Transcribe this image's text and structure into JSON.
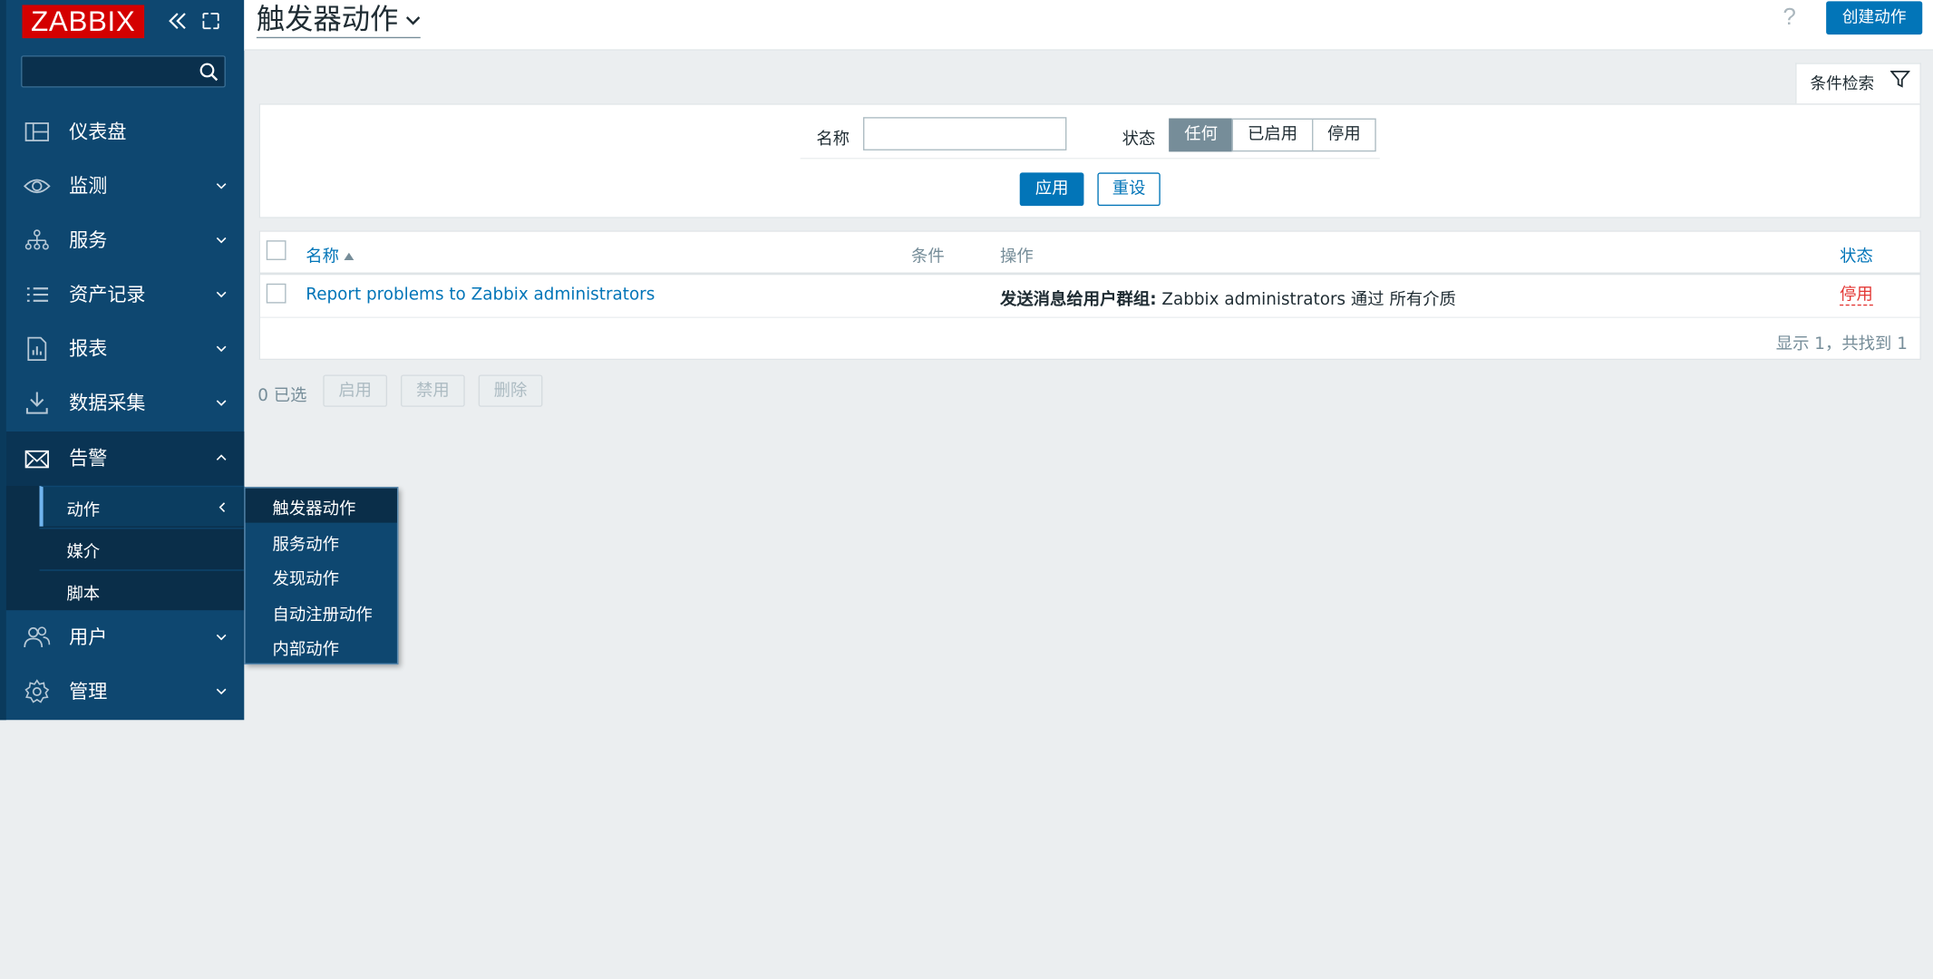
{
  "brand": {
    "logo_text": "ZABBIX",
    "logo_color": "#d40000"
  },
  "sidebar": {
    "search": {
      "placeholder": "",
      "value": ""
    },
    "items": [
      {
        "label": "仪表盘",
        "icon": "dashboard-icon"
      },
      {
        "label": "监测",
        "icon": "eye-icon"
      },
      {
        "label": "服务",
        "icon": "services-icon"
      },
      {
        "label": "资产记录",
        "icon": "list-icon"
      },
      {
        "label": "报表",
        "icon": "report-icon"
      },
      {
        "label": "数据采集",
        "icon": "download-icon"
      },
      {
        "label": "告警",
        "icon": "envelope-icon"
      },
      {
        "label": "用户",
        "icon": "users-icon"
      },
      {
        "label": "管理",
        "icon": "gear-icon"
      }
    ],
    "alerts_submenu": [
      {
        "label": "动作"
      },
      {
        "label": "媒介"
      },
      {
        "label": "脚本"
      }
    ],
    "actions_flyout": [
      {
        "label": "触发器动作"
      },
      {
        "label": "服务动作"
      },
      {
        "label": "发现动作"
      },
      {
        "label": "自动注册动作"
      },
      {
        "label": "内部动作"
      }
    ]
  },
  "header": {
    "title": "触发器动作",
    "help": "?",
    "create_button": "创建动作"
  },
  "filter": {
    "tab_label": "条件检索",
    "name_label": "名称",
    "name_value": "",
    "status_label": "状态",
    "status_options": [
      "任何",
      "已启用",
      "停用"
    ],
    "status_selected": "任何",
    "apply": "应用",
    "reset": "重设"
  },
  "table": {
    "columns": [
      "名称",
      "条件",
      "操作",
      "状态"
    ],
    "rows": [
      {
        "name": "Report problems to Zabbix administrators",
        "conditions": "",
        "operation_bold": "发送消息给用户群组:",
        "operation_rest": " Zabbix administrators 通过 所有介质",
        "status": "停用"
      }
    ],
    "footer": "显示 1，共找到 1"
  },
  "bulk": {
    "selected": "0 已选",
    "buttons": [
      "启用",
      "禁用",
      "删除"
    ]
  },
  "colors": {
    "sidebar_bg": "#0e4770",
    "accent": "#0275b8",
    "disabled_red": "#e33734"
  }
}
